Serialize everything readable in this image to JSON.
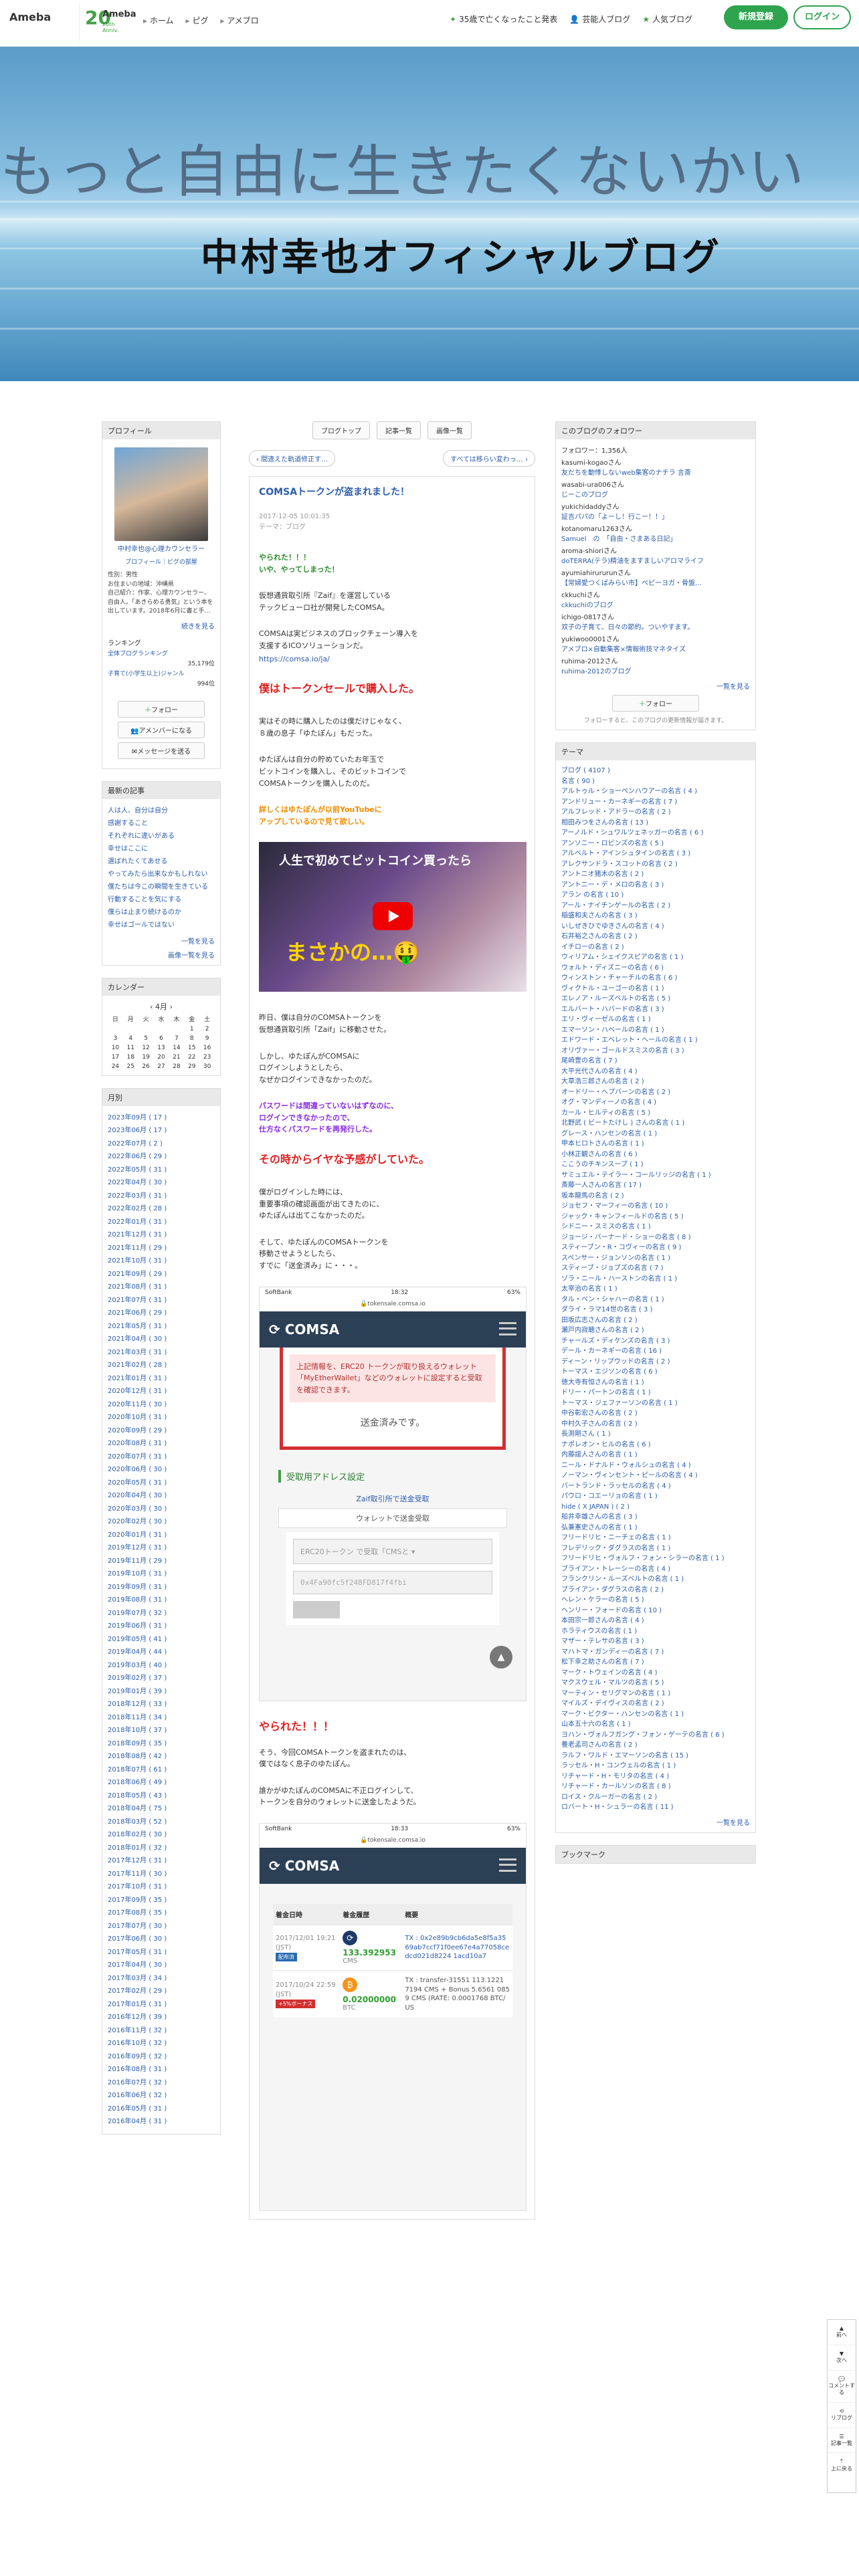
{
  "header": {
    "logo": "Ameba",
    "anniv_num": "20",
    "anniv_title": "Ameba",
    "anniv_sub": "20th Anniv.",
    "nav": [
      "ホーム",
      "ピグ",
      "アメブロ"
    ],
    "links": [
      "35歳で亡くなったこと発表",
      "芸能人ブログ",
      "人気ブログ"
    ],
    "signup": "新規登録",
    "login": "ログイン"
  },
  "hero": {
    "tagline": "もっと自由に生きたくないかい",
    "title": "中村幸也オフィシャルブログ"
  },
  "profile": {
    "heading": "プロフィール",
    "name": "中村幸也@心理カウンセラー",
    "links": "プロフィール｜ピグの部屋",
    "text": "性別：男性\nお住まいの地域：沖縄県\n自己紹介：作家、心理カウンセラー、自由人。「あきらめる勇気」という本を出しています。2018年6月に書と手…",
    "more": "続きを見る",
    "ranking_h": "ランキング",
    "rank1_label": "全体ブログランキング",
    "rank1_value": "35,179位",
    "rank2_label": "子育て(小学生以上)ジャンル",
    "rank2_value": "994位",
    "follow_btn": "フォロー",
    "member_btn": "アメンバーになる",
    "message_btn": "メッセージを送る"
  },
  "recent": {
    "heading": "最新の記事",
    "items": [
      "人は人、自分は自分",
      "感謝すること",
      "それぞれに違いがある",
      "幸せはここに",
      "選ばれたくてあせる",
      "やってみたら出来なかもしれない",
      "僕たちは今この瞬間を生きている",
      "行動することを気にする",
      "僕らは止まり続けるのか",
      "幸せはゴールではない"
    ],
    "more": "一覧を見る",
    "img_more": "画像一覧を見る"
  },
  "calendar": {
    "heading": "カレンダー",
    "month": "4月",
    "days": [
      "日",
      "月",
      "火",
      "水",
      "木",
      "金",
      "土"
    ],
    "cells": [
      "",
      "",
      "",
      "",
      "",
      "1",
      "2",
      "3",
      "4",
      "5",
      "6",
      "7",
      "8",
      "9",
      "10",
      "11",
      "12",
      "13",
      "14",
      "15",
      "16",
      "17",
      "18",
      "19",
      "20",
      "21",
      "22",
      "23",
      "24",
      "25",
      "26",
      "27",
      "28",
      "29",
      "30"
    ]
  },
  "months": {
    "heading": "月別",
    "items": [
      "2023年09月 ( 17 )",
      "2023年06月 ( 17 )",
      "2022年07月 ( 2 )",
      "2022年06月 ( 29 )",
      "2022年05月 ( 31 )",
      "2022年04月 ( 30 )",
      "2022年03月 ( 31 )",
      "2022年02月 ( 28 )",
      "2022年01月 ( 31 )",
      "2021年12月 ( 31 )",
      "2021年11月 ( 29 )",
      "2021年10月 ( 31 )",
      "2021年09月 ( 29 )",
      "2021年08月 ( 31 )",
      "2021年07月 ( 31 )",
      "2021年06月 ( 29 )",
      "2021年05月 ( 31 )",
      "2021年04月 ( 30 )",
      "2021年03月 ( 31 )",
      "2021年02月 ( 28 )",
      "2021年01月 ( 31 )",
      "2020年12月 ( 31 )",
      "2020年11月 ( 30 )",
      "2020年10月 ( 31 )",
      "2020年09月 ( 29 )",
      "2020年08月 ( 31 )",
      "2020年07月 ( 31 )",
      "2020年06月 ( 30 )",
      "2020年05月 ( 31 )",
      "2020年04月 ( 30 )",
      "2020年03月 ( 30 )",
      "2020年02月 ( 30 )",
      "2020年01月 ( 31 )",
      "2019年12月 ( 31 )",
      "2019年11月 ( 29 )",
      "2019年10月 ( 31 )",
      "2019年09月 ( 31 )",
      "2019年08月 ( 31 )",
      "2019年07月 ( 32 )",
      "2019年06月 ( 31 )",
      "2019年05月 ( 41 )",
      "2019年04月 ( 44 )",
      "2019年03月 ( 40 )",
      "2019年02月 ( 37 )",
      "2019年01月 ( 39 )",
      "2018年12月 ( 33 )",
      "2018年11月 ( 34 )",
      "2018年10月 ( 37 )",
      "2018年09月 ( 35 )",
      "2018年08月 ( 42 )",
      "2018年07月 ( 61 )",
      "2018年06月 ( 49 )",
      "2018年05月 ( 43 )",
      "2018年04月 ( 75 )",
      "2018年03月 ( 52 )",
      "2018年02月 ( 30 )",
      "2018年01月 ( 32 )",
      "2017年12月 ( 31 )",
      "2017年11月 ( 30 )",
      "2017年10月 ( 31 )",
      "2017年09月 ( 35 )",
      "2017年08月 ( 35 )",
      "2017年07月 ( 30 )",
      "2017年06月 ( 30 )",
      "2017年05月 ( 31 )",
      "2017年04月 ( 30 )",
      "2017年03月 ( 34 )",
      "2017年02月 ( 29 )",
      "2017年01月 ( 31 )",
      "2016年12月 ( 39 )",
      "2016年11月 ( 32 )",
      "2016年10月 ( 32 )",
      "2016年09月 ( 32 )",
      "2016年08月 ( 31 )",
      "2016年07月 ( 32 )",
      "2016年06月 ( 32 )",
      "2016年05月 ( 31 )",
      "2016年04月 ( 31 )"
    ]
  },
  "article": {
    "top_nav": [
      "ブログトップ",
      "記事一覧",
      "画像一覧"
    ],
    "prev": "間違えた軌道修正す…",
    "next": "すべては移らい変わっ…",
    "title": "COMSAトークンが盗まれました！",
    "date": "2017-12-05 10:01:35",
    "theme": "テーマ：ブログ",
    "p1": "やられた！！！\nいや、やってしまった！",
    "p2": "仮想通貨取引所『Zaif』を運営している\nテックビューロ社が開発したCOMSA。",
    "p3": "COMSAは実ビジネスのブロックチェーン導入を\n支援するICOソリューションだ。",
    "p3_link": "https://comsa.io/ja/",
    "h1": "僕はトークンセールで購入した。",
    "p4": "実はその時に購入したのは僕だけじゃなく、\n８歳の息子「ゆたぽん」もだった。",
    "p5": "ゆたぽんは自分の貯めていたお年玉で\nビットコインを購入し、そのビットコインで\nCOMSAトークンを購入したのだ。",
    "p6": "詳しくはゆたぽんが以前YouTubeに\nアップしているので見て欲しい。",
    "video_title": "人生で初めてビットコイン買ったら",
    "video_sub": "まさかの…🤑",
    "p7": "昨日、僕は自分のCOMSAトークンを\n仮想通貨取引所「Zaif」に移動させた。",
    "p8": "しかし、ゆたぽんがCOMSAに\nログインしようとしたら、\nなぜかログインできなかったのだ。",
    "p9": "パスワードは間違っていないはずなのに、\nログインできなかったので、\n仕方なくパスワードを再発行した。",
    "h2": "その時からイヤな予感がしていた。",
    "p10": "僕がログインした時には、\n重要事項の確認画面が出てきたのに、\nゆたぽんは出てこなかったのだ。",
    "p11": "そして、ゆたぽんのCOMSAトークンを\n移動させようとしたら、\nすでに「送金済み」に・・・。",
    "shot1": {
      "carrier": "SoftBank",
      "time": "18:32",
      "battery": "63%",
      "url": "tokensale.comsa.io",
      "app": "COMSA",
      "warn": "上記情報を、ERC20 トークンが取り扱えるウォレット「MyEtherWallet」などのウォレットに設定すると受取を確認できます。",
      "sent": "送金済みです。",
      "addr_h": "受取用アドレス設定",
      "tab1": "Zaif取引所で送金受取",
      "tab2": "ウォレットで送金受取",
      "select": "ERC20トークン で受取「CMSと",
      "addr": "0x4Fa90fc5f248FD817f4fbi"
    },
    "h3": "やられた！！！",
    "p12": "そう、今回COMSAトークンを盗まれたのは、\n僕ではなく息子のゆたぽん。",
    "p13": "誰かがゆたぽんのCOMSAに不正ログインして、\nトークンを自分のウォレットに送金したようだ。",
    "shot2": {
      "carrier": "SoftBank",
      "time": "18:33",
      "battery": "63%",
      "url": "tokensale.comsa.io",
      "app": "COMSA",
      "col1": "着金日時",
      "col2": "着金履歴",
      "col3": "概要",
      "row1_date": "2017/12/01 19:21 (JST)",
      "row1_badge": "配布済",
      "row1_amt": "133.392953",
      "row1_unit": "CMS",
      "row1_tx": "TX : 0x2e89b9cb6da5e8f5a3569ab7ccf71f0ee67e4a77058cedcd021d8224 1acd10a7",
      "row2_date": "2017/10/24 22:59 (JST)",
      "row2_badge": "+5%ボーナス",
      "row2_amt": "0.02000000",
      "row2_unit": "BTC",
      "row2_tx": "TX : transfer-31551 113.1221 7194 CMS + Bonus 5.6561 0859 CMS (RATE: 0.0001768 BTC/US"
    }
  },
  "followers": {
    "heading": "このブログのフォロワー",
    "count": "フォロワー：1,356人",
    "items": [
      {
        "user": "kasumi-kogaoさん",
        "blog": "友だちを動悸しないweb集客のナチラ 言斎"
      },
      {
        "user": "wasabi-ura006さん",
        "blog": "じーこのブログ"
      },
      {
        "user": "yukichidaddyさん",
        "blog": "証吉パパの「よーし！行こー！！」"
      },
      {
        "user": "kotanomaru1263さん",
        "blog": "Samuel　の　「自由・さまある日記」"
      },
      {
        "user": "aroma-shioriさん",
        "blog": "doTERRA(テラ)精油をますましいアロマライフ"
      },
      {
        "user": "ayumiahirururunさん",
        "blog": "【常婦愛つくばみらい市】ペピーヨガ・骨盤…"
      },
      {
        "user": "ckkuchiさん",
        "blog": "ckkuchiのブログ"
      },
      {
        "user": "ichigo-0817さん",
        "blog": "双子の子育て、日々の節約。ついやすます。"
      },
      {
        "user": "yukiwoo0001さん",
        "blog": "アメブロ×自動集客×情報術技マネタイズ"
      },
      {
        "user": "ruhima-2012さん",
        "blog": "ruhima-2012のブログ"
      }
    ],
    "more": "一覧を見る",
    "follow_btn": "フォロー",
    "note": "フォローすると、このブログの更新情報が届きます。"
  },
  "themes": {
    "heading": "テーマ",
    "items": [
      "ブログ ( 4107 )",
      "名言 ( 90 )",
      "アルトゥル・ショーペンハウアーの名言 ( 4 )",
      "アンドリュー・カーネギーの名言 ( 7 )",
      "アルフレッド・アドラーの名言 ( 2 )",
      "相田みつをさんの名言 ( 13 )",
      "アーノルド・シュワルツェネッガーの名言 ( 6 )",
      "アンソニー・ロビンズの名言 ( 5 )",
      "アルベルト・アインシュタインの名言 ( 3 )",
      "アレクサンドラ・スコットの名言 ( 2 )",
      "アントニオ猪木の名言 ( 2 )",
      "アントニー・デ・メロの名言 ( 3 )",
      "アラン の名言 ( 10 )",
      "アール・ナイチンゲールの名言 ( 2 )",
      "稲盛和夫さんの名言 ( 3 )",
      "いしぜきひでゆきさんの名言 ( 4 )",
      "石井裕之さんの名言 ( 2 )",
      "イチローの名言 ( 2 )",
      "ウィリアム・シェイクスピアの名言 ( 1 )",
      "ウォルト・ディズニーの名言 ( 6 )",
      "ウィンストン・チャーチルの名言 ( 6 )",
      "ヴィクトル・ユーゴーの名言 ( 1 )",
      "エレノア・ルーズベルトの名言 ( 5 )",
      "エルバート・ハバードの名言 ( 3 )",
      "エリ・ヴィーゼルの名言 ( 1 )",
      "エマーソン・ハベールの名言 ( 1 )",
      "エドワード・エベレット・ヘールの名言 ( 1 )",
      "オリヴァー・ゴールドスミスの名言 ( 3 )",
      "尾崎豊の名言 ( 7 )",
      "大平光代さんの名言 ( 4 )",
      "大草浩三郎さんの名言 ( 2 )",
      "オードリー・ヘプバーンの名言 ( 2 )",
      "オグ・マンディーノの名言 ( 4 )",
      "カール・ヒルティの名言 ( 5 )",
      "北野武 ( ビートたけし ) さんの名言 ( 1 )",
      "グレース・ハンセンの名言 ( 1 )",
      "甲本ヒロトさんの名言 ( 1 )",
      "小林正観さんの名言 ( 6 )",
      "ここうのチキンスープ ( 1 )",
      "サミュエル・テイラー・コールリッジの名言 ( 1 )",
      "斎藤一人さんの名言 ( 17 )",
      "坂本龍馬の名言 ( 2 )",
      "ジョセフ・マーフィーの名言 ( 10 )",
      "ジャック・キャンフィールドの名言 ( 5 )",
      "シドニー・スミスの名言 ( 1 )",
      "ジョージ・バーナード・ショーの名言 ( 8 )",
      "スティーブン・R・コヴィーの名言 ( 9 )",
      "スペンサー・ジョンソンの名言 ( 1 )",
      "スティーブ・ジョブズの名言 ( 7 )",
      "ゾラ・ニール・ハーストンの名言 ( 1 )",
      "太宰治の名言 ( 1 )",
      "タル・ベン・シャハーの名言 ( 1 )",
      "ダライ・ラマ14世の名言 ( 3 )",
      "田坂広志さんの名言 ( 2 )",
      "瀬戸内寂聴さんの名言 ( 2 )",
      "チャールズ・ディケンズの名言 ( 3 )",
      "デール・カーネギーの名言 ( 16 )",
      "ディーン・リップウッドの名言 ( 2 )",
      "トーマス・エジソンの名言 ( 6 )",
      "徳大寺有恒さんの名言 ( 1 )",
      "ドリー・パートンの名言 ( 1 )",
      "トーマス・ジェファーソンの名言 ( 1 )",
      "中谷彰宏さんの名言 ( 2 )",
      "中村久子さんの名言 ( 2 )",
      "長渕剛さん ( 1 )",
      "ナポレオン・ヒルの名言 ( 6 )",
      "内藤誼人さんの名言 ( 1 )",
      "ニール・ドナルド・ウォルシュの名言 ( 4 )",
      "ノーマン・ヴィンセント・ピールの名言 ( 4 )",
      "バートランド・ラッセルの名言 ( 4 )",
      "パウロ・コエーリョの名言 ( 1 )",
      "hide ( X JAPAN ) ( 2 )",
      "船井幸雄さんの名言 ( 3 )",
      "弘兼憲史さんの名言 ( 1 )",
      "フリードリヒ・ニーチェの名言 ( 1 )",
      "フレデリック・ダグラスの名言 ( 1 )",
      "フリードリヒ・ヴォルフ・フォン・シラーの名言 ( 1 )",
      "ブライアン・トレーシーの名言 ( 4 )",
      "フランクリン・ルーズベルトの名言 ( 1 )",
      "ブライアン・ダグラスの名言 ( 2 )",
      "ヘレン・ケラーの名言 ( 5 )",
      "ヘンリー・フォードの名言 ( 10 )",
      "本田宗一郎さんの名言 ( 4 )",
      "ホラティウスの名言 ( 1 )",
      "マザー・テレサの名言 ( 3 )",
      "マハトマ・ガンディーの名言 ( 7 )",
      "松下幸之助さんの名言 ( 7 )",
      "マーク・トウェインの名言 ( 4 )",
      "マクスウェル・マルツの名言 ( 5 )",
      "マーティン・セリグマンの名言 ( 1 )",
      "マイルズ・デイヴィスの名言 ( 2 )",
      "マーク・ビクター・ハンセンの名言 ( 1 )",
      "山本五十六の名言 ( 1 )",
      "ヨハン・ヴォルフガング・フォン・ゲーテの名言 ( 6 )",
      "養老孟司さんの名言 ( 2 )",
      "ラルフ・ワルド・エマーソンの名言 ( 15 )",
      "ラッセル・H・コンウェルの名言 ( 1 )",
      "リチャード・H・モリタの名言 ( 4 )",
      "リチャード・カールソンの名言 ( 8 )",
      "ロイス・クルーガーの名言 ( 2 )",
      "ロバート・H・シュラーの名言 ( 11 )"
    ],
    "more": "一覧を見る"
  },
  "bookmark": {
    "heading": "ブックマーク"
  },
  "sidefix": [
    "前へ",
    "次へ",
    "コメントする",
    "リブログ",
    "記事一覧",
    "上に戻る"
  ]
}
